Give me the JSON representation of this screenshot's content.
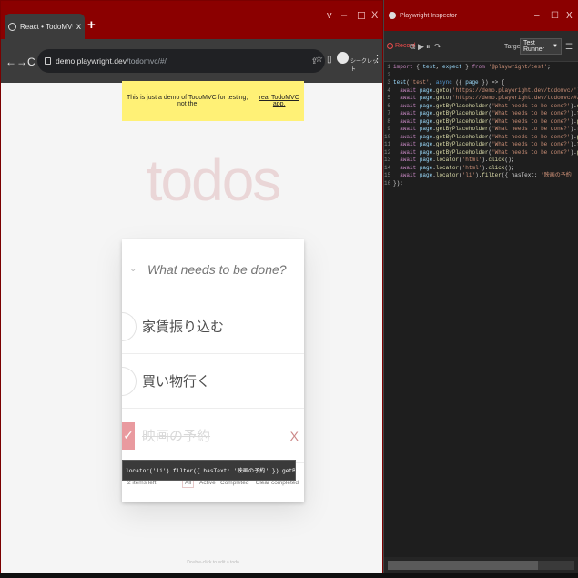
{
  "browser": {
    "tab_title": "React • TodoMVC",
    "tab_close": "x",
    "new_tab": "+",
    "controls": {
      "collapse": "v",
      "minimize": "–",
      "maximize": "☐",
      "close": "X"
    },
    "nav": {
      "back": "←",
      "forward": "→",
      "reload": "C"
    },
    "url_host": "demo.playwright.dev",
    "url_path": "/todomvc/#/",
    "guest_label": "シークレット"
  },
  "todo_app": {
    "notice": "This is just a demo of TodoMVC for testing, not the",
    "notice_link": "real TodoMVC app.",
    "logo": "todos",
    "new_todo_placeholder": "What needs to be done?",
    "items": [
      {
        "label": "家賃振り込む",
        "completed": false
      },
      {
        "label": "買い物行く",
        "completed": false
      },
      {
        "label": "映画の予約",
        "completed": true
      }
    ],
    "destroy_glyph": "X",
    "footer": {
      "count": "2 items left",
      "filters": [
        "All",
        "Active",
        "Completed"
      ],
      "selected_filter": "All",
      "clear": "Clear completed"
    },
    "tooltip": "locator('li').filter({ hasText: '映画の予約' }).getByLabel('Toggle Todo')",
    "info": "Double-click to edit a todo"
  },
  "inspector": {
    "title": "Playwright Inspector",
    "controls": {
      "minimize": "–",
      "maximize": "☐",
      "close": "X"
    },
    "record_label": "Record",
    "target_label": "Target:",
    "target_value": "Test Runner",
    "code_lines": [
      "import { test, expect } from '@playwright/test';",
      "",
      "test('test', async ({ page }) => {",
      "  await page.goto('https://demo.playwright.dev/todomvc/');",
      "  await page.goto('https://demo.playwright.dev/todomvc/#/');",
      "  await page.getByPlaceholder('What needs to be done?').click();",
      "  await page.getByPlaceholder('What needs to be done?').fill('家賃振り込む');",
      "  await page.getByPlaceholder('What needs to be done?').press('Enter');",
      "  await page.getByPlaceholder('What needs to be done?').fill('買い物行く');",
      "  await page.getByPlaceholder('What needs to be done?').press('Enter');",
      "  await page.getByPlaceholder('What needs to be done?').fill('映画の予約');",
      "  await page.getByPlaceholder('What needs to be done?').press('Enter');",
      "  await page.locator('html').click();",
      "  await page.locator('html').click();",
      "  await page.locator('li').filter({ hasText: '映画の予約' }).getByLabel('Toggle Todo').check();",
      "});"
    ]
  },
  "colors": {
    "title_bar": "#8b0000",
    "notice_bg": "#fff176",
    "completed_check": "#e99a9f",
    "record_red": "#f14c4c"
  }
}
